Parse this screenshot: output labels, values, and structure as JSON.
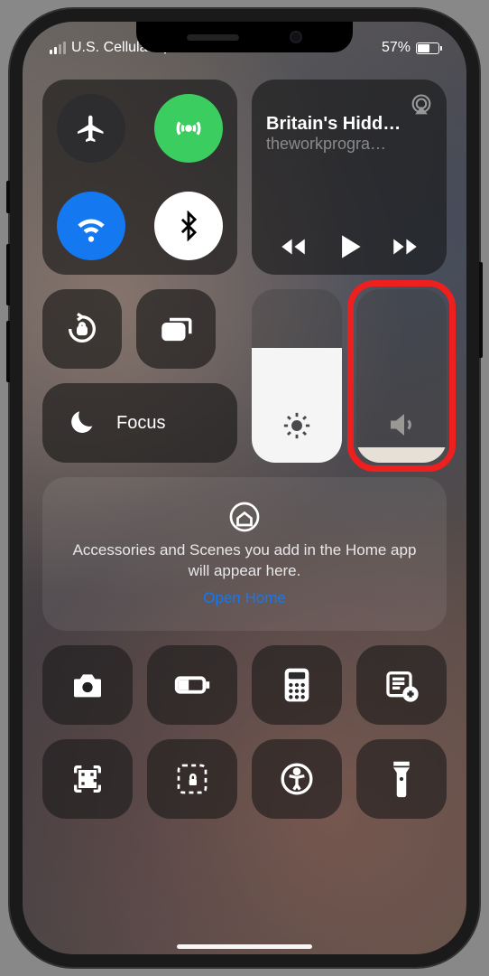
{
  "status": {
    "carrier": "U.S. Cellular",
    "battery_text": "57%"
  },
  "connectivity": {
    "airplane": false,
    "cellular": true,
    "wifi": true,
    "bluetooth": true
  },
  "music": {
    "title": "Britain's Hidd…",
    "subtitle": "theworkprogra…"
  },
  "focus": {
    "label": "Focus"
  },
  "brightness": {
    "level_percent": 66
  },
  "volume": {
    "level_percent": 9,
    "highlighted": true
  },
  "home": {
    "message": "Accessories and Scenes you add in the Home app will appear here.",
    "link": "Open Home"
  },
  "shortcuts": [
    {
      "name": "camera"
    },
    {
      "name": "low-power"
    },
    {
      "name": "calculator"
    },
    {
      "name": "notes-add"
    },
    {
      "name": "qr-scanner"
    },
    {
      "name": "guided-access"
    },
    {
      "name": "accessibility"
    },
    {
      "name": "flashlight"
    }
  ]
}
